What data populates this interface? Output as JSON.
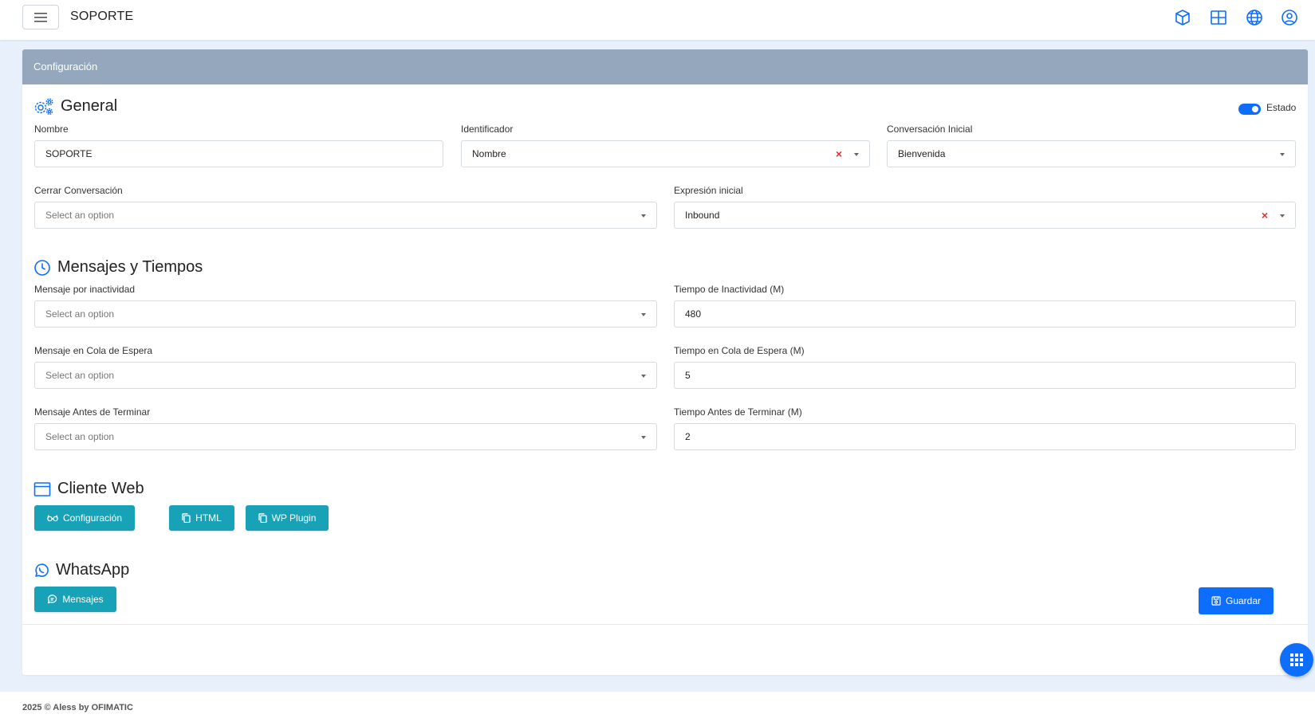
{
  "topbar": {
    "title": "SOPORTE",
    "icons": [
      "cube-icon",
      "grid-icon",
      "globe-icon",
      "user-circle-icon"
    ]
  },
  "card": {
    "header": "Configuración",
    "general": {
      "title": "General",
      "estado_label": "Estado",
      "estado_on": true,
      "nombre": {
        "label": "Nombre",
        "value": "SOPORTE"
      },
      "identificador": {
        "label": "Identificador",
        "value": "Nombre"
      },
      "conversacion_inicial": {
        "label": "Conversación Inicial",
        "value": "Bienvenida"
      },
      "cerrar_conversacion": {
        "label": "Cerrar Conversación",
        "placeholder": "Select an option"
      },
      "expresion_inicial": {
        "label": "Expresión inicial",
        "value": "Inbound"
      }
    },
    "mensajes": {
      "title": "Mensajes y Tiempos",
      "msg_inactividad": {
        "label": "Mensaje por inactividad",
        "placeholder": "Select an option"
      },
      "tiempo_inactividad": {
        "label": "Tiempo de Inactividad (M)",
        "value": "480"
      },
      "msg_cola": {
        "label": "Mensaje en Cola de Espera",
        "placeholder": "Select an option"
      },
      "tiempo_cola": {
        "label": "Tiempo en Cola de Espera (M)",
        "value": "5"
      },
      "msg_terminar": {
        "label": "Mensaje Antes de Terminar",
        "placeholder": "Select an option"
      },
      "tiempo_terminar": {
        "label": "Tiempo Antes de Terminar (M)",
        "value": "2"
      }
    },
    "cliente_web": {
      "title": "Cliente Web",
      "buttons": [
        "Configuración",
        "HTML",
        "WP Plugin"
      ]
    },
    "whatsapp": {
      "title": "WhatsApp",
      "button": "Mensajes"
    },
    "save_label": "Guardar"
  },
  "footer": "2025 © Aless by OFIMATIC",
  "colors": {
    "primary": "#0d6efd",
    "teal": "#17a2b8",
    "header": "#94a7bd",
    "clear": "#e0312f"
  }
}
